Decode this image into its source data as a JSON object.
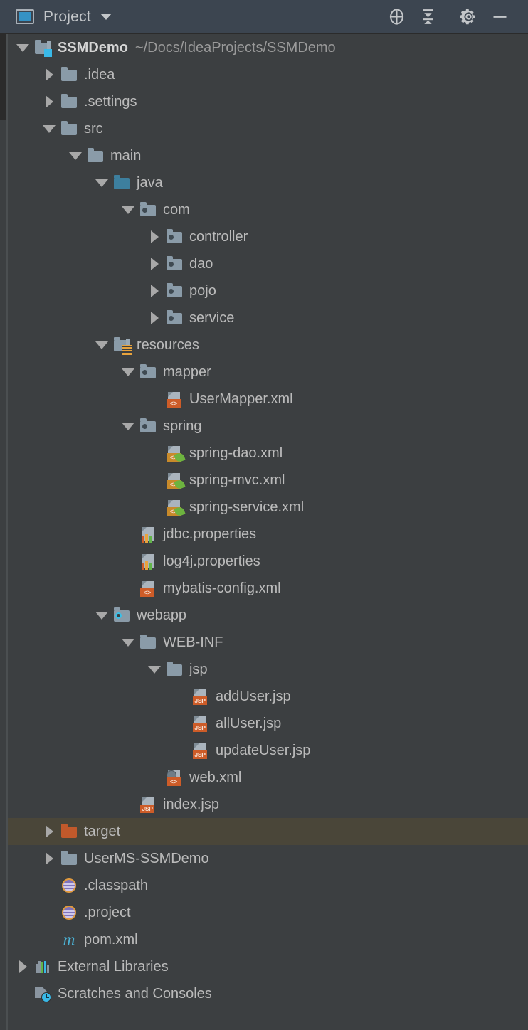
{
  "window": {
    "title": "Project",
    "icons": {
      "project_icon": "project-window-icon",
      "dropdown": "chevron-down-icon",
      "locate": "scroll-from-source-icon",
      "collapse": "collapse-all-icon",
      "settings": "gear-icon",
      "minimize": "minimize-icon"
    }
  },
  "colors": {
    "header_bg": "#3c4550",
    "tree_bg": "#3c3f41",
    "selection_bg": "#4a4639",
    "text": "#bbbbbb",
    "dim_text": "#9a9a9a",
    "accent_blue": "#3592c4",
    "source_root": "#3d7f9e",
    "excluded_orange": "#c1592b",
    "badge_orange": "#cd5c28",
    "spring_green": "#6db33f",
    "maven_cyan": "#4bb3d6",
    "eclipse_purple": "#7e72bd"
  },
  "tree": {
    "rows": [
      {
        "label": "SSMDemo",
        "sublabel": "~/Docs/IdeaProjects/SSMDemo",
        "depth": 0,
        "toggle": "expanded",
        "icon": "module-folder-icon",
        "bold": true,
        "selected": false
      },
      {
        "label": ".idea",
        "depth": 1,
        "toggle": "collapsed",
        "icon": "folder-icon",
        "selected": false
      },
      {
        "label": ".settings",
        "depth": 1,
        "toggle": "collapsed",
        "icon": "folder-icon",
        "selected": false
      },
      {
        "label": "src",
        "depth": 1,
        "toggle": "expanded",
        "icon": "folder-icon",
        "selected": false
      },
      {
        "label": "main",
        "depth": 2,
        "toggle": "expanded",
        "icon": "folder-icon",
        "selected": false
      },
      {
        "label": "java",
        "depth": 3,
        "toggle": "expanded",
        "icon": "source-root-folder-icon",
        "selected": false
      },
      {
        "label": "com",
        "depth": 4,
        "toggle": "expanded",
        "icon": "package-icon",
        "selected": false
      },
      {
        "label": "controller",
        "depth": 5,
        "toggle": "collapsed",
        "icon": "package-icon",
        "selected": false
      },
      {
        "label": "dao",
        "depth": 5,
        "toggle": "collapsed",
        "icon": "package-icon",
        "selected": false
      },
      {
        "label": "pojo",
        "depth": 5,
        "toggle": "collapsed",
        "icon": "package-icon",
        "selected": false
      },
      {
        "label": "service",
        "depth": 5,
        "toggle": "collapsed",
        "icon": "package-icon",
        "selected": false
      },
      {
        "label": "resources",
        "depth": 3,
        "toggle": "expanded",
        "icon": "resource-root-folder-icon",
        "selected": false
      },
      {
        "label": "mapper",
        "depth": 4,
        "toggle": "expanded",
        "icon": "package-icon",
        "selected": false
      },
      {
        "label": "UserMapper.xml",
        "depth": 5,
        "toggle": "none",
        "icon": "xml-file-icon",
        "badge": "<>",
        "selected": false
      },
      {
        "label": "spring",
        "depth": 4,
        "toggle": "expanded",
        "icon": "package-icon",
        "selected": false
      },
      {
        "label": "spring-dao.xml",
        "depth": 5,
        "toggle": "none",
        "icon": "spring-xml-file-icon",
        "badge": "<>",
        "selected": false
      },
      {
        "label": "spring-mvc.xml",
        "depth": 5,
        "toggle": "none",
        "icon": "spring-xml-file-icon",
        "badge": "<>",
        "selected": false
      },
      {
        "label": "spring-service.xml",
        "depth": 5,
        "toggle": "none",
        "icon": "spring-xml-file-icon",
        "badge": "<>",
        "selected": false
      },
      {
        "label": "jdbc.properties",
        "depth": 4,
        "toggle": "none",
        "icon": "properties-file-icon",
        "selected": false
      },
      {
        "label": "log4j.properties",
        "depth": 4,
        "toggle": "none",
        "icon": "properties-file-icon",
        "selected": false
      },
      {
        "label": "mybatis-config.xml",
        "depth": 4,
        "toggle": "none",
        "icon": "xml-file-icon",
        "badge": "<>",
        "selected": false
      },
      {
        "label": "webapp",
        "depth": 3,
        "toggle": "expanded",
        "icon": "web-root-folder-icon",
        "selected": false
      },
      {
        "label": "WEB-INF",
        "depth": 4,
        "toggle": "expanded",
        "icon": "folder-icon",
        "selected": false
      },
      {
        "label": "jsp",
        "depth": 5,
        "toggle": "expanded",
        "icon": "folder-icon",
        "selected": false
      },
      {
        "label": "addUser.jsp",
        "depth": 6,
        "toggle": "none",
        "icon": "jsp-file-icon",
        "badge": "JSP",
        "selected": false
      },
      {
        "label": "allUser.jsp",
        "depth": 6,
        "toggle": "none",
        "icon": "jsp-file-icon",
        "badge": "JSP",
        "selected": false
      },
      {
        "label": "updateUser.jsp",
        "depth": 6,
        "toggle": "none",
        "icon": "jsp-file-icon",
        "badge": "JSP",
        "selected": false
      },
      {
        "label": "web.xml",
        "depth": 5,
        "toggle": "none",
        "icon": "web-xml-file-icon",
        "badge": "<>",
        "selected": false
      },
      {
        "label": "index.jsp",
        "depth": 4,
        "toggle": "none",
        "icon": "jsp-file-icon",
        "badge": "JSP",
        "selected": false
      },
      {
        "label": "target",
        "depth": 1,
        "toggle": "collapsed",
        "icon": "excluded-folder-icon",
        "selected": true
      },
      {
        "label": "UserMS-SSMDemo",
        "depth": 1,
        "toggle": "collapsed",
        "icon": "folder-icon",
        "selected": false
      },
      {
        "label": ".classpath",
        "depth": 1,
        "toggle": "none",
        "icon": "eclipse-file-icon",
        "selected": false
      },
      {
        "label": ".project",
        "depth": 1,
        "toggle": "none",
        "icon": "eclipse-file-icon",
        "selected": false
      },
      {
        "label": "pom.xml",
        "depth": 1,
        "toggle": "none",
        "icon": "maven-file-icon",
        "selected": false
      },
      {
        "label": "External Libraries",
        "depth": 0,
        "toggle": "collapsed",
        "icon": "libraries-icon",
        "selected": false
      },
      {
        "label": "Scratches and Consoles",
        "depth": 0,
        "toggle": "none",
        "icon": "scratches-icon",
        "selected": false
      }
    ]
  }
}
